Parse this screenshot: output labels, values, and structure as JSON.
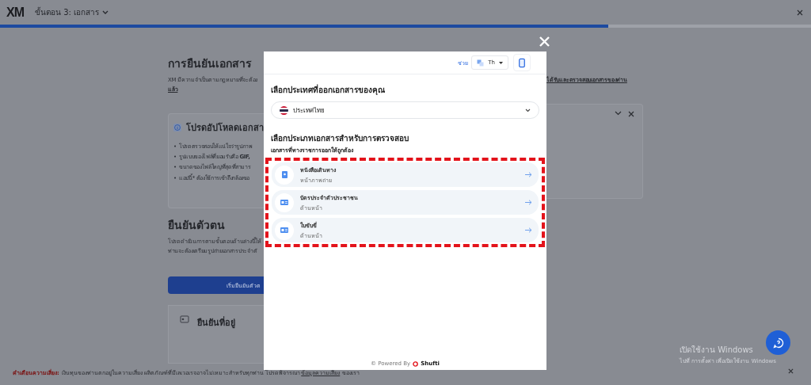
{
  "header": {
    "logo": "XM",
    "step": "ขั้นตอน 3: เอกสาร",
    "progress": {
      "level": 0.75
    }
  },
  "background": {
    "title": "การยืนยันเอกสาร",
    "intro_left": "XM มีความจำเป็นตามกฎหมายที่จะต้อง",
    "intro_right": "ได้รับและตรวจสอบเอกสารของท่าน",
    "intro_end": "แล้ว",
    "notice": {
      "title": "โปรดอัปโหลดเอกสา",
      "expanded": true,
      "marker": "•",
      "bullets": [
        "โปรดตรวจสอบให้แน่ใจว่ารูปภาพ",
        "รูปแบบของไฟล์ที่ยอมรับคือ **GIF,**",
        "ขนาดของไฟล์ใหญ่ที่สุดที่สามาร",
        "แอปนี้* ต้องใช้การเข้าถึงกล้องขอ"
      ]
    },
    "identity_title": "ยืนยันตัวตน",
    "identity_lines": [
      "โปรดดำเนินการตามขั้นตอนด้านล่างนี้ให้",
      "ท่านจะต้องเตรียมรูปถ่ายเอกสารประจำตั"
    ],
    "identity_button": "เริ่มยืนยันตัวต",
    "address_title": "ยืนยันที่อยู่"
  },
  "warning": {
    "label": "คำเตือนความเสี่ยง:",
    "text": "เงินทุนของท่านตกอยู่ในความเสี่ยง ผลิตภัณฑ์ที่มีเลเวอเรจอาจไม่เหมาะสำหรับทุกท่าน โปรดพิจารณา",
    "link": "ข้อมูลความเสี่ยง",
    "after": "ของเรา"
  },
  "os_notice": {
    "title": "เปิดใช้งาน Windows",
    "text": "ไปที่ การตั้งค่า เพื่อเปิดใช้งาน Windows"
  },
  "modal": {
    "help": "ช่วย",
    "language": "Th",
    "country_label": "เลือกประเทศที่ออกเอกสารของคุณ",
    "country": "ประเทศไทย",
    "doc_label": "เลือกประเภทเอกสารสำหรับการตรวจสอบ",
    "doc_hint": "เอกสารที่ทางราชการออกให้ถูกต้อง",
    "documents": [
      {
        "kind": "passport",
        "title": "หนังสือเดินทาง",
        "subtitle": "หน้าภาพถ่าย"
      },
      {
        "kind": "card",
        "title": "บัตรประจำตัวประชาชน",
        "subtitle": "ด้านหน้า"
      },
      {
        "kind": "card",
        "title": "ใบขับขี่",
        "subtitle": "ด้านหน้า"
      }
    ],
    "powered": "© Powered By",
    "brand": "Shufti"
  }
}
